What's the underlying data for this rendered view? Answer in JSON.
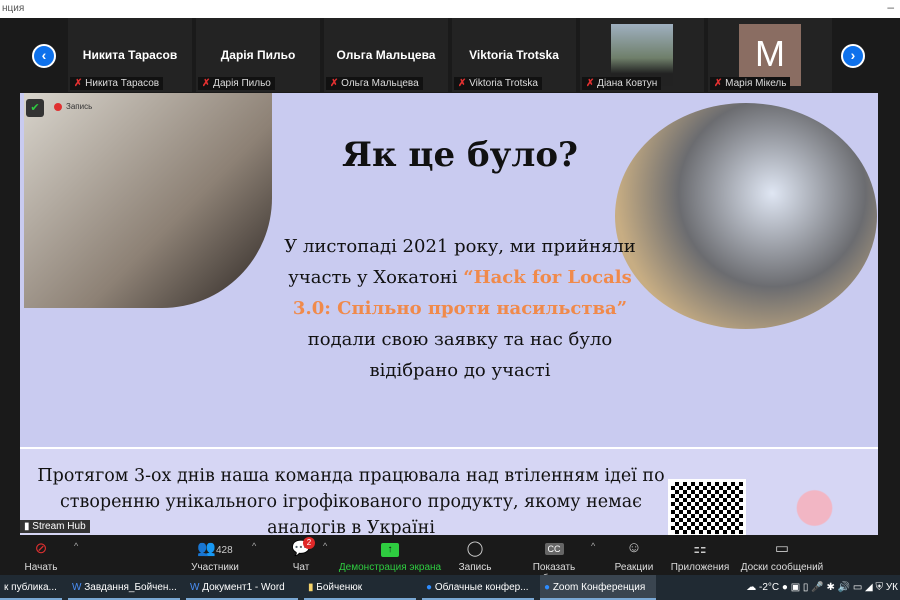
{
  "window": {
    "title": "нция"
  },
  "participants": [
    {
      "name": "Никита Тарасов",
      "label": "Никита Тарасов",
      "video": false
    },
    {
      "name": "Дарія Пильо",
      "label": "Дарія Пильо",
      "video": false
    },
    {
      "name": "Ольга Мальцева",
      "label": "Ольга Мальцева",
      "video": false
    },
    {
      "name": "Viktoria Trotska",
      "label": "Viktoria Trotska",
      "video": false
    },
    {
      "name": "",
      "label": "Діана Ковтун",
      "video": true
    },
    {
      "name": "M",
      "label": "Марія Мікель",
      "video": false
    }
  ],
  "recording": {
    "label": "Запись"
  },
  "slide": {
    "title": "Як це було?",
    "body_1": "У листопаді 2021 року, ми прийняли участь у Хокатоні",
    "highlight": "“Hack for Locals 3.0: Спільно проти насильства”",
    "body_2": "подали свою заявку та нас було відібрано до участі",
    "section2": "Протягом 3-ох днів наша команда працювала над втіленням ідеї по створенню унікального ігрофікованого продукту, якому немає аналогів в Україні"
  },
  "stream_hub": "Stream Hub",
  "toolbar": {
    "video": "Начать видео",
    "participants": "Участники",
    "participants_count": "428",
    "chat": "Чат",
    "chat_badge": "2",
    "share": "Демонстрация экрана",
    "record": "Запись",
    "captions": "Показать субтитры",
    "reactions": "Реакции",
    "apps": "Приложения",
    "whiteboards": "Доски сообщений"
  },
  "taskbar": {
    "items": [
      "к публика...",
      "Завдання_Бойчен...",
      "Документ1 - Word",
      "Бойченюк",
      "Облачные конфер...",
      "Zoom Конференция"
    ],
    "temperature": "-2°C",
    "lang": "УК"
  }
}
